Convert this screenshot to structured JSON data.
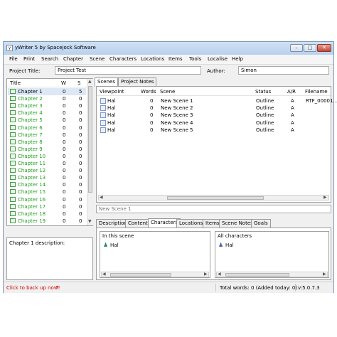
{
  "window": {
    "title": "yWriter 5 by Spacejock Software",
    "min": "–",
    "max": "□",
    "close": "✕"
  },
  "menu": [
    "File",
    "Print",
    "Search",
    "Chapter",
    "Scene",
    "Characters",
    "Locations",
    "Items",
    "Tools",
    "Localise",
    "Help"
  ],
  "project": {
    "title_label": "Project Title:",
    "title_value": "Project Test",
    "author_label": "Author:",
    "author_value": "Simon"
  },
  "chapters": {
    "headers": [
      "Title",
      "W",
      "S"
    ],
    "rows": [
      [
        "Chapter 1",
        "0",
        "5"
      ],
      [
        "Chapter 2",
        "0",
        "0"
      ],
      [
        "Chapter 3",
        "0",
        "0"
      ],
      [
        "Chapter 4",
        "0",
        "0"
      ],
      [
        "Chapter 5",
        "0",
        "0"
      ],
      [
        "Chapter 6",
        "0",
        "0"
      ],
      [
        "Chapter 7",
        "0",
        "0"
      ],
      [
        "Chapter 8",
        "0",
        "0"
      ],
      [
        "Chapter 9",
        "0",
        "0"
      ],
      [
        "Chapter 10",
        "0",
        "0"
      ],
      [
        "Chapter 11",
        "0",
        "0"
      ],
      [
        "Chapter 12",
        "0",
        "0"
      ],
      [
        "Chapter 13",
        "0",
        "0"
      ],
      [
        "Chapter 14",
        "0",
        "0"
      ],
      [
        "Chapter 15",
        "0",
        "0"
      ],
      [
        "Chapter 16",
        "0",
        "0"
      ],
      [
        "Chapter 17",
        "0",
        "0"
      ],
      [
        "Chapter 18",
        "0",
        "0"
      ],
      [
        "Chapter 19",
        "0",
        "0"
      ]
    ],
    "description_label": "Chapter 1 description:"
  },
  "top_tabs": [
    "Scenes",
    "Project Notes"
  ],
  "scenes": {
    "headers": [
      "Viewpoint",
      "Words",
      "Scene",
      "Status",
      "A/R",
      "Filename"
    ],
    "rows": [
      [
        "Hal",
        "0",
        "New Scene 1",
        "Outline",
        "A",
        "RTF_00001..."
      ],
      [
        "Hal",
        "0",
        "New Scene 2",
        "Outline",
        "A",
        ""
      ],
      [
        "Hal",
        "0",
        "New Scene 3",
        "Outline",
        "A",
        ""
      ],
      [
        "Hal",
        "0",
        "New Scene 4",
        "Outline",
        "A",
        ""
      ],
      [
        "Hal",
        "0",
        "New Scene 5",
        "Outline",
        "A",
        ""
      ]
    ]
  },
  "scene_name_field": "New Scene 1",
  "bottom_tabs": [
    "Description",
    "Content",
    "Characters",
    "Locations",
    "Items",
    "Scene Notes",
    "Goals"
  ],
  "characters_pane": {
    "in_scene_label": "In this scene",
    "in_scene": [
      "Hal"
    ],
    "all_label": "All characters",
    "all": [
      "Hal"
    ]
  },
  "status": {
    "backup": "Click to back up now!",
    "total_words": "Total words: 0 (Added today: 0)",
    "version": "v:5.0.7.3"
  },
  "colors": {
    "chapter_text": "#1e9e1e",
    "backup_text": "#d00000"
  }
}
